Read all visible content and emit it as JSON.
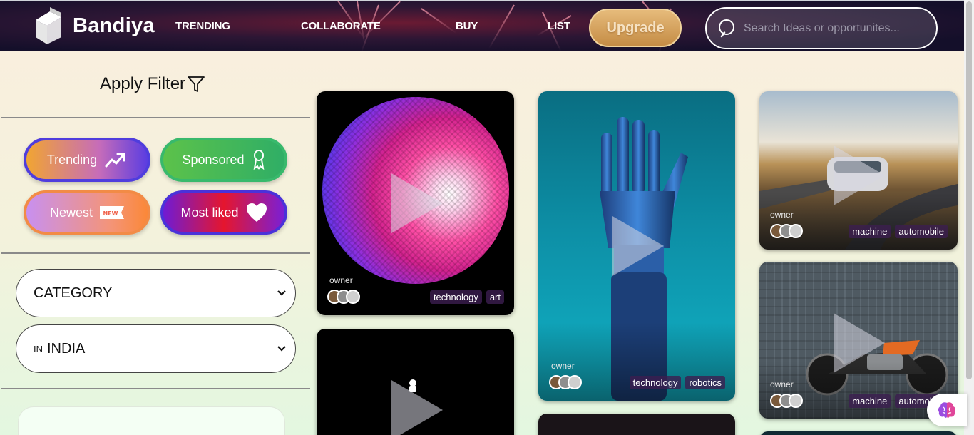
{
  "brand": {
    "name": "Bandiya"
  },
  "nav": {
    "trending": "TRENDING",
    "collaborate": "COLLABORATE",
    "buy": "BUY",
    "list": "LIST",
    "upgrade": "Upgrade"
  },
  "search": {
    "placeholder": "Search Ideas or opportunites..."
  },
  "sidebar": {
    "filter_title": "Apply Filter",
    "pills": {
      "trending": "Trending",
      "sponsored": "Sponsored",
      "newest": "Newest",
      "newest_badge": "NEW",
      "most_liked": "Most liked"
    },
    "category_select": {
      "value": "CATEGORY"
    },
    "location_select": {
      "prefix": "IN",
      "value": "INDIA"
    }
  },
  "cards": [
    {
      "owner": "owner",
      "tags": [
        "technology",
        "art"
      ]
    },
    {
      "owner": "owner",
      "tags": [
        "technology",
        "robotics"
      ]
    },
    {
      "owner": "owner",
      "tags": [
        "machine",
        "automobile"
      ]
    },
    {
      "owner": "owner",
      "tags": [
        "machine",
        "automobile"
      ]
    }
  ],
  "colors": {
    "upgrade": "#d9a55f",
    "tag_bg": "#3c1e50",
    "trending_border": "#4f3ddd",
    "sponsored": "#38b96c",
    "most_liked": "#e5162e"
  },
  "icons": {
    "filter": "funnel-icon",
    "trending": "trending-up-icon",
    "sponsored": "award-ribbon-icon",
    "newest": "new-badge-icon",
    "most_liked": "heart-icon",
    "search": "search-icon",
    "play": "play-icon",
    "assistant": "brain-icon"
  }
}
